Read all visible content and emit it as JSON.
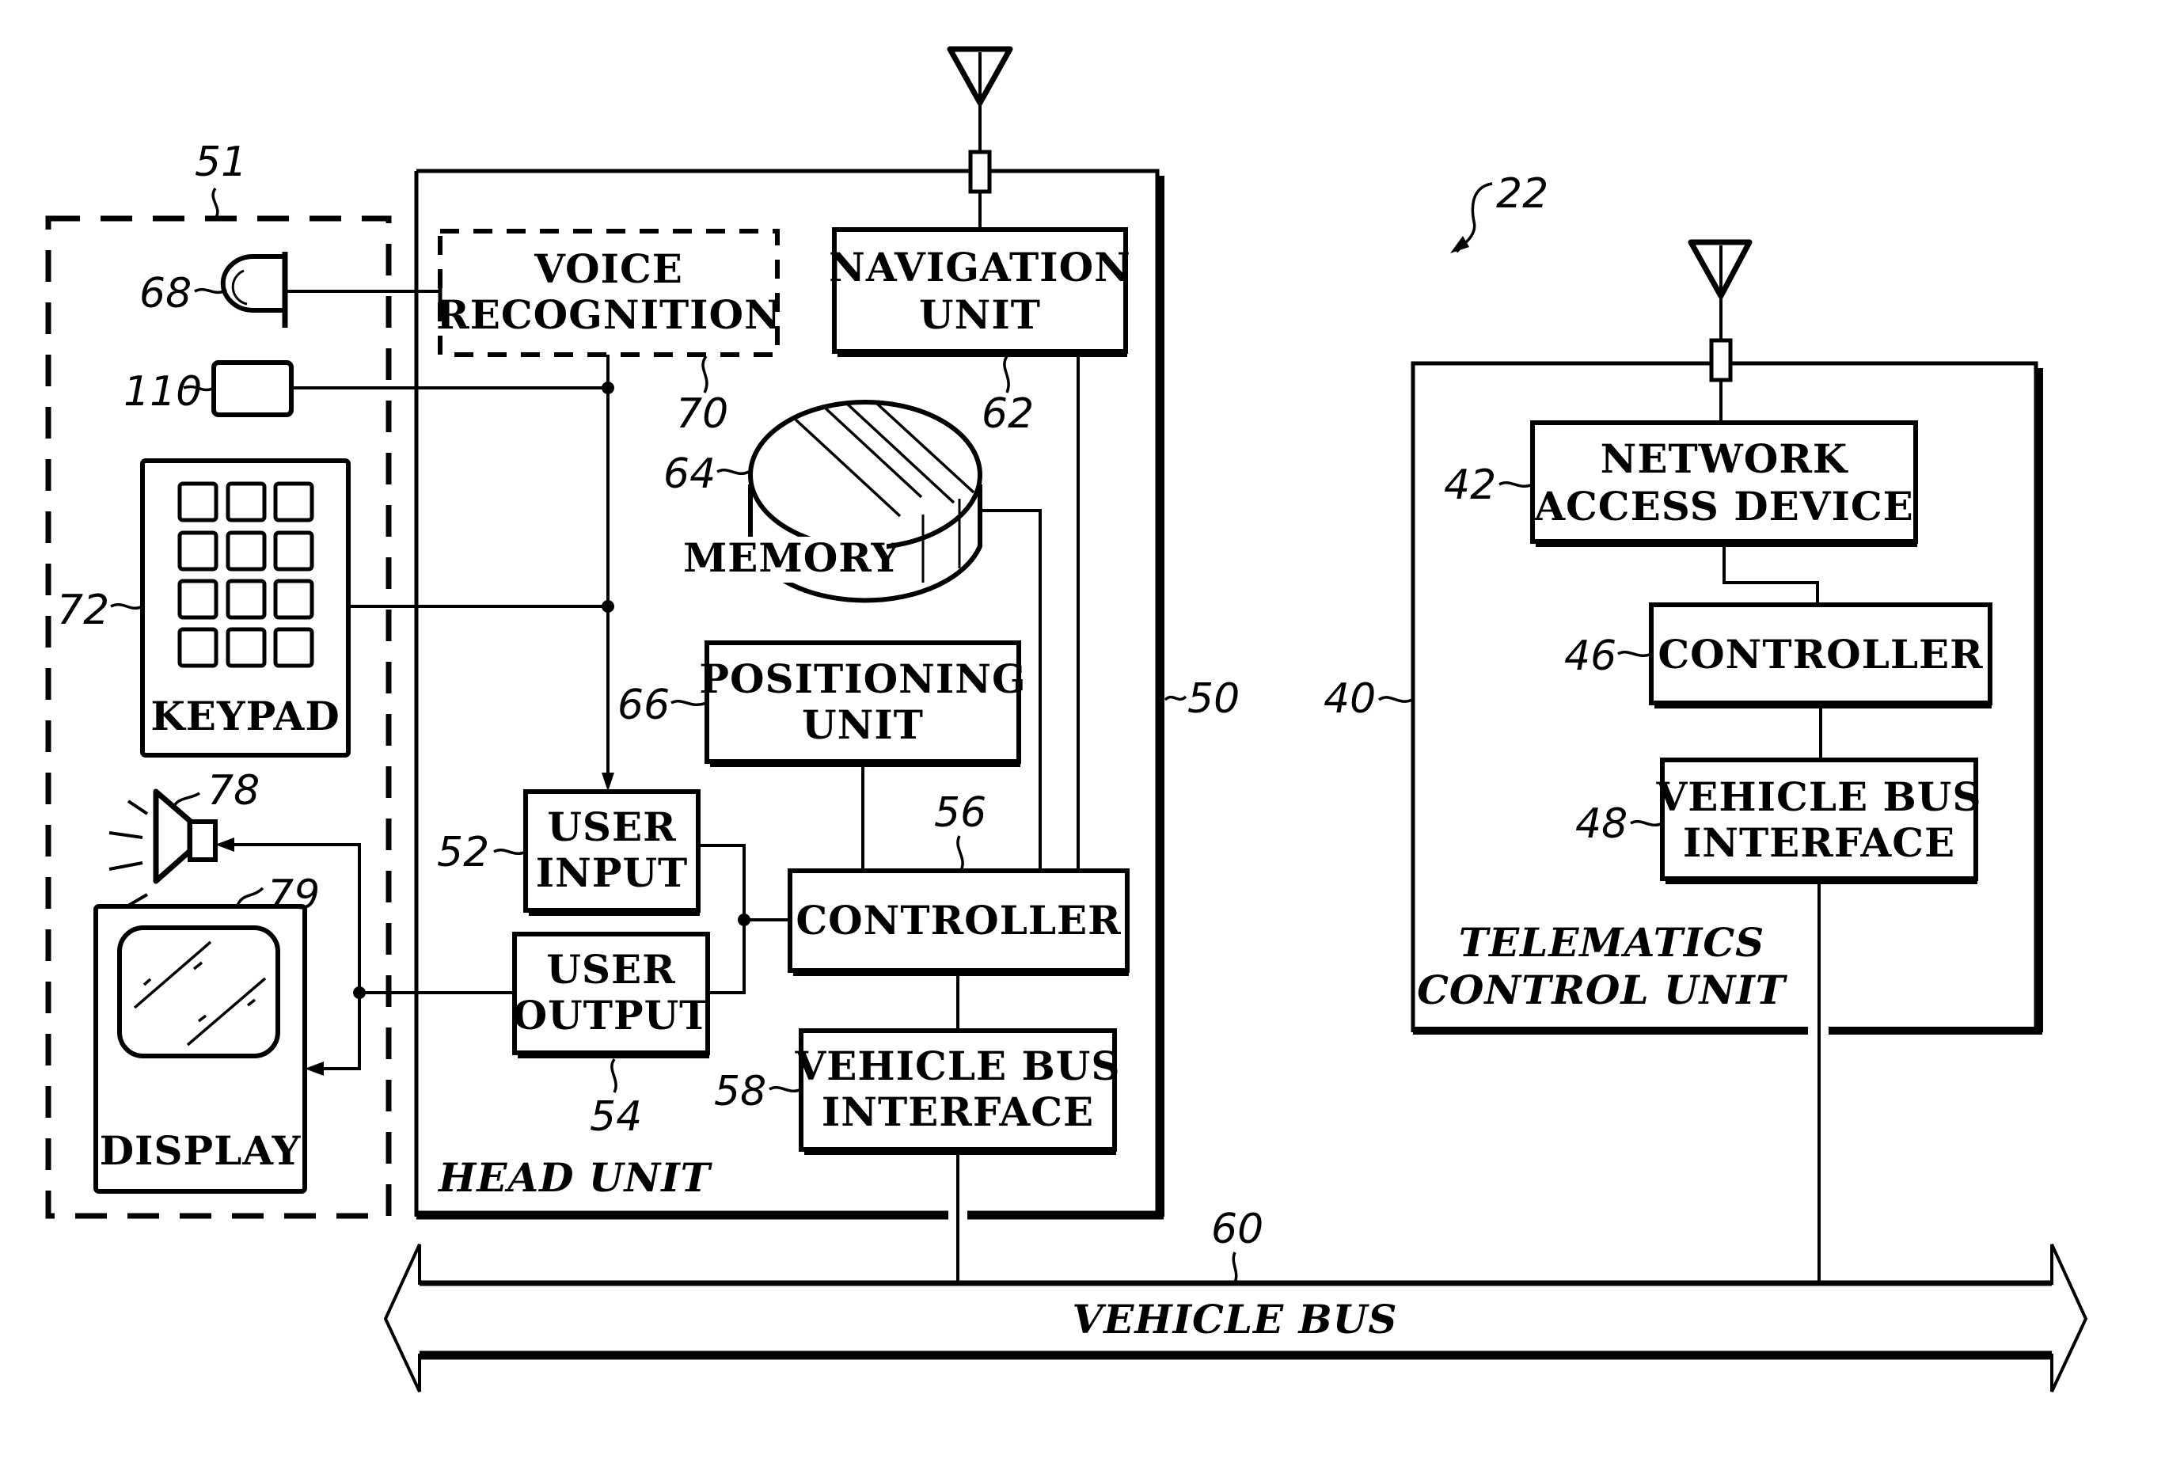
{
  "figure": {
    "system_ref": "22",
    "bus": {
      "ref": "60",
      "label": "VEHICLE BUS"
    },
    "user_interface_group": {
      "ref": "51",
      "components": {
        "microphone": {
          "ref": "68"
        },
        "button": {
          "ref": "110"
        },
        "keypad": {
          "ref": "72",
          "label": "KEYPAD"
        },
        "speaker": {
          "ref": "78"
        },
        "display": {
          "ref": "79",
          "label": "DISPLAY"
        }
      }
    },
    "head_unit": {
      "ref": "50",
      "title": "HEAD UNIT",
      "blocks": {
        "voice_recognition": {
          "ref": "70",
          "line1": "VOICE",
          "line2": "RECOGNITION"
        },
        "navigation_unit": {
          "ref": "62",
          "line1": "NAVIGATION",
          "line2": "UNIT"
        },
        "memory": {
          "ref": "64",
          "label": "MEMORY"
        },
        "positioning_unit": {
          "ref": "66",
          "line1": "POSITIONING",
          "line2": "UNIT"
        },
        "user_input": {
          "ref": "52",
          "line1": "USER",
          "line2": "INPUT"
        },
        "user_output": {
          "ref": "54",
          "line1": "USER",
          "line2": "OUTPUT"
        },
        "controller": {
          "ref": "56",
          "label": "CONTROLLER"
        },
        "vehicle_bus_interface": {
          "ref": "58",
          "line1": "VEHICLE BUS",
          "line2": "INTERFACE"
        }
      }
    },
    "telematics_unit": {
      "ref": "40",
      "title_line1": "TELEMATICS",
      "title_line2": "CONTROL UNIT",
      "blocks": {
        "network_access_device": {
          "ref": "42",
          "line1": "NETWORK",
          "line2": "ACCESS DEVICE"
        },
        "controller": {
          "ref": "46",
          "label": "CONTROLLER"
        },
        "vehicle_bus_interface": {
          "ref": "48",
          "line1": "VEHICLE BUS",
          "line2": "INTERFACE"
        }
      }
    }
  }
}
